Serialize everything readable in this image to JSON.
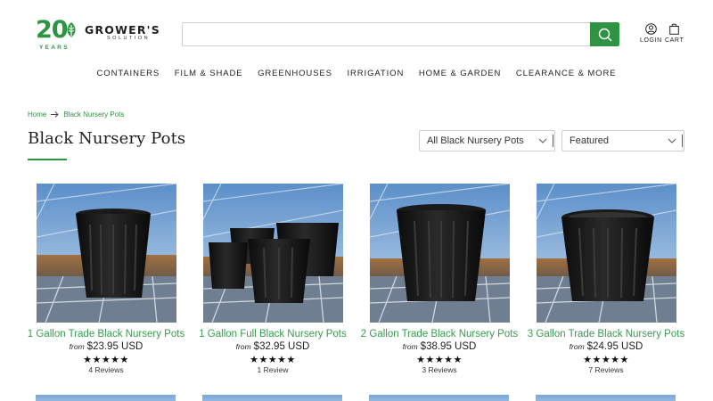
{
  "header": {
    "logo_number": "20",
    "logo_years": "YEARS",
    "logo_brand": "GROWER'S",
    "logo_sub": "SOLUTION",
    "search_value": "",
    "search_placeholder": "",
    "login_label": "LOGIN",
    "cart_label": "CART"
  },
  "nav": {
    "items": [
      "CONTAINERS",
      "FILM & SHADE",
      "GREENHOUSES",
      "IRRIGATION",
      "HOME & GARDEN",
      "CLEARANCE & MORE"
    ]
  },
  "breadcrumb": {
    "home": "Home",
    "current": "Black Nursery Pots"
  },
  "page": {
    "title": "Black Nursery Pots"
  },
  "filters": {
    "category_selected": "All Black Nursery Pots",
    "sort_selected": "Featured"
  },
  "products": [
    {
      "name": "1 Gallon Trade Black Nursery Pots",
      "from": "from",
      "price": "$23.95 USD",
      "stars": "★★★★★",
      "reviews": "4 Reviews"
    },
    {
      "name": "1 Gallon Full Black Nursery Pots",
      "from": "from",
      "price": "$32.95 USD",
      "stars": "★★★★★",
      "reviews": "1 Review"
    },
    {
      "name": "2 Gallon Trade Black Nursery Pots",
      "from": "from",
      "price": "$38.95 USD",
      "stars": "★★★★★",
      "reviews": "3 Reviews"
    },
    {
      "name": "3 Gallon Trade Black Nursery Pots",
      "from": "from",
      "price": "$24.95 USD",
      "stars": "★★★★★",
      "reviews": "7 Reviews"
    }
  ],
  "colors": {
    "accent": "#2e9444",
    "product_link": "#3a9a4f"
  }
}
